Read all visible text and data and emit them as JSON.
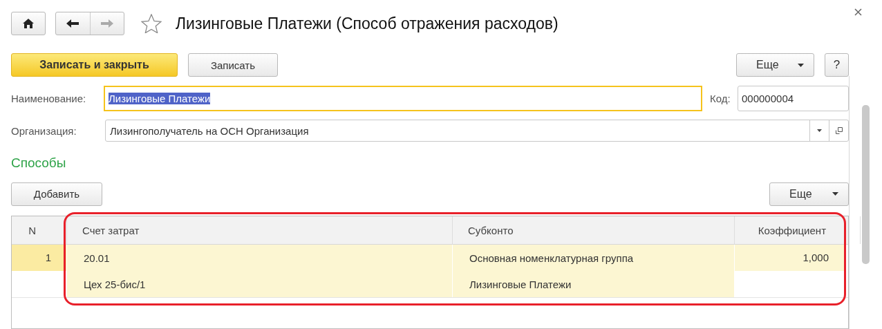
{
  "window": {
    "title": "Лизинговые Платежи (Способ отражения расходов)",
    "favorite": false
  },
  "toolbar": {
    "primary": "Записать и закрыть",
    "secondary": "Записать",
    "more": "Еще",
    "help": "?"
  },
  "fields": [
    {
      "label": "Наименование:",
      "value": "Лизинговые Платежи",
      "focused": true,
      "text_selected": true
    },
    {
      "label": "Код:",
      "value": "000000004"
    },
    {
      "label": "Организация:",
      "value": "Лизингополучатель на ОСН Организация"
    }
  ],
  "section": {
    "title": "Способы",
    "add_button": "Добавить",
    "more": "Еще"
  },
  "table": {
    "columns": [
      "N",
      "Счет затрат",
      "Субконто",
      "Коэффициент"
    ],
    "rows": [
      {
        "n": "1",
        "account": [
          "20.01",
          "Цех 25-бис/1"
        ],
        "subconto": [
          "Основная номенклатурная группа",
          "Лизинговые Платежи"
        ],
        "coefficient": "1,000",
        "selected": true
      }
    ]
  }
}
